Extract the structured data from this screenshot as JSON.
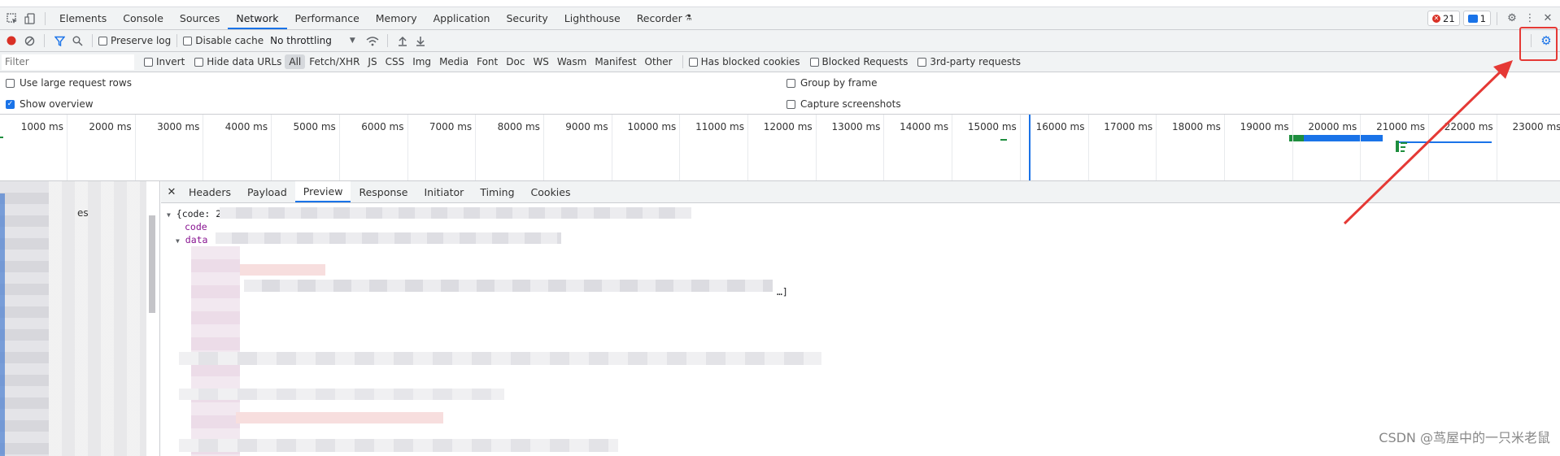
{
  "tabs": {
    "items": [
      {
        "label": "Elements"
      },
      {
        "label": "Console"
      },
      {
        "label": "Sources"
      },
      {
        "label": "Network",
        "active": true
      },
      {
        "label": "Performance"
      },
      {
        "label": "Memory"
      },
      {
        "label": "Application"
      },
      {
        "label": "Security"
      },
      {
        "label": "Lighthouse"
      },
      {
        "label": "Recorder"
      }
    ],
    "errors_count": "21",
    "messages_count": "1"
  },
  "toolbar": {
    "preserve_log": "Preserve log",
    "disable_cache": "Disable cache",
    "throttling": "No throttling"
  },
  "filter": {
    "placeholder": "Filter",
    "invert": "Invert",
    "hide_data_urls": "Hide data URLs",
    "types": [
      "All",
      "Fetch/XHR",
      "JS",
      "CSS",
      "Img",
      "Media",
      "Font",
      "Doc",
      "WS",
      "Wasm",
      "Manifest",
      "Other"
    ],
    "has_blocked_cookies": "Has blocked cookies",
    "blocked_requests": "Blocked Requests",
    "third_party": "3rd-party requests"
  },
  "settings": {
    "large_rows": "Use large request rows",
    "show_overview": "Show overview",
    "group_by_frame": "Group by frame",
    "capture_screenshots": "Capture screenshots"
  },
  "overview": {
    "ticks": [
      "1000 ms",
      "2000 ms",
      "3000 ms",
      "4000 ms",
      "5000 ms",
      "6000 ms",
      "7000 ms",
      "8000 ms",
      "9000 ms",
      "10000 ms",
      "11000 ms",
      "12000 ms",
      "13000 ms",
      "14000 ms",
      "15000 ms",
      "16000 ms",
      "17000 ms",
      "18000 ms",
      "19000 ms",
      "20000 ms",
      "21000 ms",
      "22000 ms",
      "23000 ms"
    ]
  },
  "detail": {
    "tabs": [
      "Headers",
      "Payload",
      "Preview",
      "Response",
      "Initiator",
      "Timing",
      "Cookies"
    ],
    "active_tab": "Preview",
    "preview_root": "{code: 2",
    "preview_key1": "code",
    "preview_key2": "data",
    "preview_ellipsis": "…]"
  },
  "left_pane": {
    "header_fragment": "es"
  },
  "watermark": "CSDN @茑屋中的一只米老鼠",
  "colors": {
    "accent": "#1a73e8",
    "record_red": "#d93025",
    "annotation_red": "#e53935"
  }
}
